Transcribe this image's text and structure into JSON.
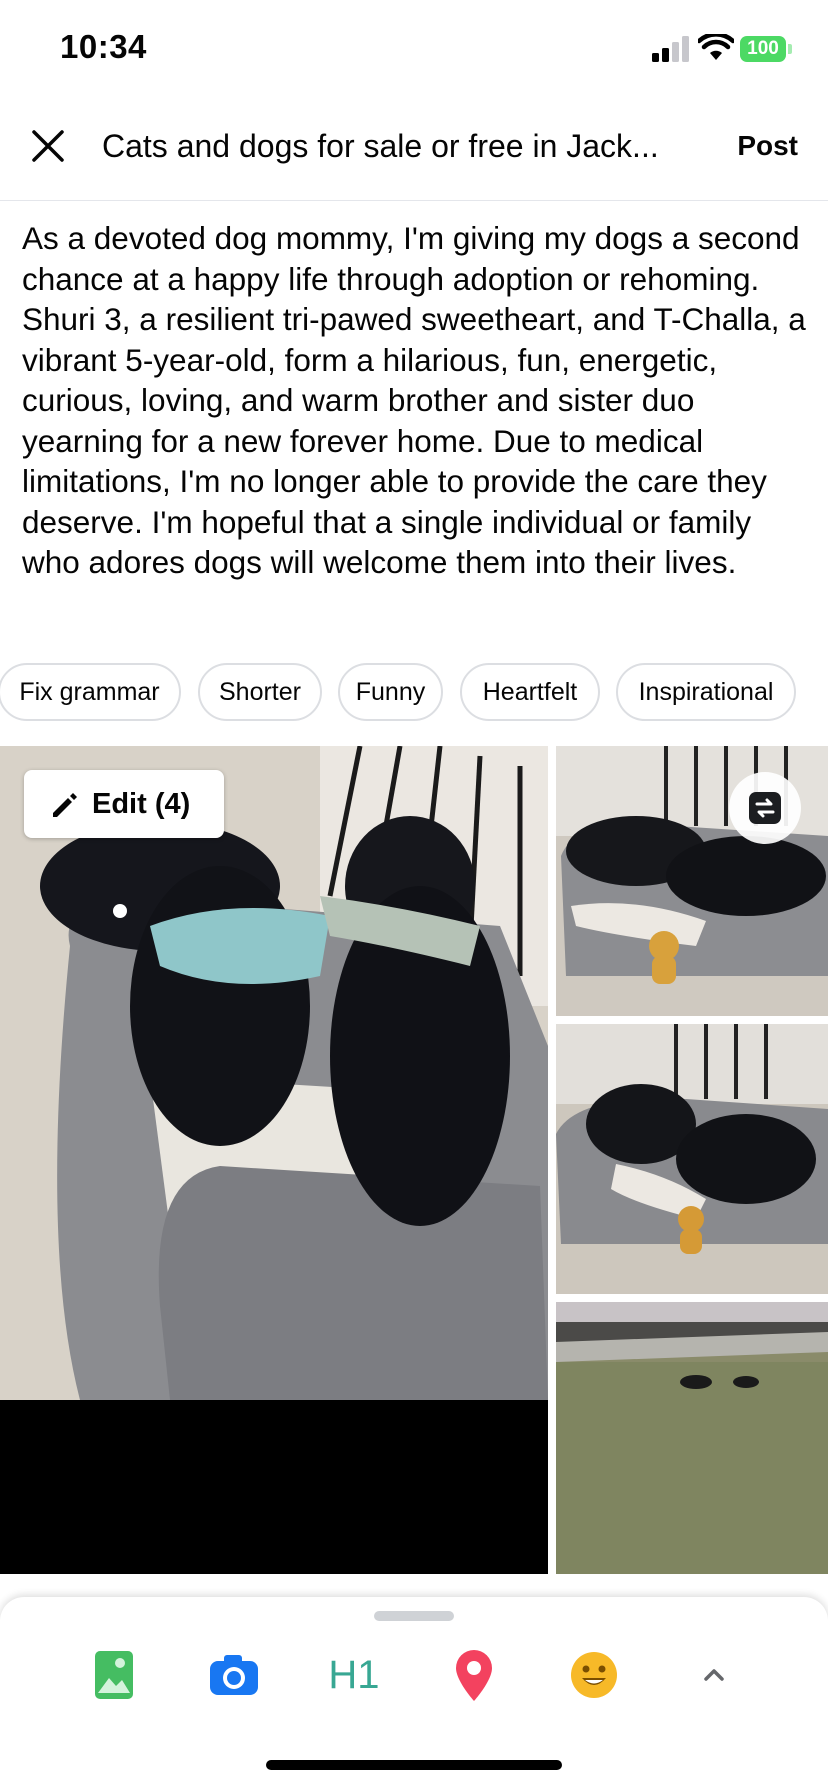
{
  "status": {
    "time": "10:34",
    "battery": "100"
  },
  "nav": {
    "title": "Cats and dogs for sale or free in Jack...",
    "post_label": "Post"
  },
  "composer": {
    "text": "As a devoted dog mommy, I'm giving my dogs a second chance at a happy life through adoption or rehoming. Shuri 3, a resilient tri-pawed sweetheart, and T-Challa, a vibrant 5-year-old, form a hilarious, fun, energetic, curious, loving, and warm brother and sister duo yearning for a new forever home. Due to medical limitations, I'm no longer able to provide the care they deserve. I'm hopeful that a single individual or family who adores dogs will welcome them into their lives."
  },
  "suggestions": [
    "Fix grammar",
    "Shorter",
    "Funny",
    "Heartfelt",
    "Inspirational"
  ],
  "photos": {
    "edit_label": "Edit (4)"
  },
  "toolbar": {
    "icons": [
      "photo-icon",
      "camera-icon",
      "heading-icon",
      "location-pin-icon",
      "emoji-icon",
      "chevron-up-icon"
    ],
    "h1_label": "H1"
  },
  "colors": {
    "photo": "#45bd62",
    "camera": "#1877f2",
    "heading": "#38a793",
    "location": "#f3425f",
    "emoji": "#f7b928"
  }
}
